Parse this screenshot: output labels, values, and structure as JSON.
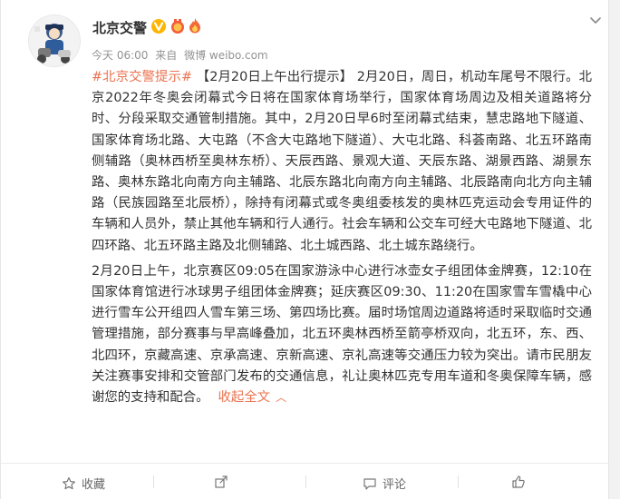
{
  "post": {
    "author": "北京交警",
    "meta": {
      "time": "今天 06:00",
      "from_label": "来自",
      "source": "微博 weibo.com"
    },
    "hashtag": "#北京交警提示#",
    "paragraph1_rest": " 【2月20日上午出行提示】 2月20日，周日，机动车尾号不限行。北京2022年冬奥会闭幕式今日将在国家体育场举行，国家体育场周边及相关道路将分时、分段采取交通管制措施。其中，2月20日早6时至闭幕式结束，慧忠路地下隧道、国家体育场北路、大屯路（不含大屯路地下隧道）、大屯北路、科荟南路、北五环路南侧辅路（奥林西桥至奥林东桥）、天辰西路、景观大道、天辰东路、湖景西路、湖景东路、奥林东路北向南方向主辅路、北辰东路北向南方向主辅路、北辰路南向北方向主辅路（民族园路至北辰桥），除持有闭幕式或冬奥组委核发的奥林匹克运动会专用证件的车辆和人员外，禁止其他车辆和行人通行。社会车辆和公交车可经大屯路地下隧道、北四环路、北五环路主路及北侧辅路、北土城西路、北土城东路绕行。",
    "paragraph2": "2月20日上午，北京赛区09:05在国家游泳中心进行冰壶女子组团体金牌赛，12:10在国家体育馆进行冰球男子组团体金牌赛；延庆赛区09:30、11:20在国家雪车雪橇中心进行雪车公开组四人雪车第三场、第四场比赛。届时场馆周边道路将适时采取临时交通管理措施，部分赛事与早高峰叠加，北五环奥林西桥至箭亭桥双向，北五环，东、西、北四环，京藏高速、京承高速、京新高速、京礼高速等交通压力较为突出。请市民朋友关注赛事安排和交管部门发布的交通信息，礼让奥林匹克专用车道和冬奥保障车辆，感谢您的支持和配合。",
    "collapse_label": "收起全文",
    "collapse_icon": "chevron-up-icon"
  },
  "footer": {
    "collect_label": "收藏",
    "share_label": "",
    "comment_label": "评论",
    "like_label": ""
  },
  "colors": {
    "accent": "#eb7350",
    "text": "#333333",
    "meta": "#939393",
    "verified": "#ffb400"
  }
}
